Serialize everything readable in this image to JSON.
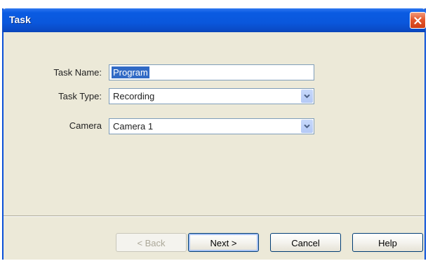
{
  "window": {
    "title": "Task"
  },
  "form": {
    "task_name": {
      "label": "Task Name:",
      "value": "Program"
    },
    "task_type": {
      "label": "Task Type:",
      "value": "Recording"
    },
    "camera": {
      "label": "Camera",
      "value": "Camera 1"
    }
  },
  "buttons": {
    "back": "< Back",
    "next": "Next >",
    "cancel": "Cancel",
    "help": "Help"
  },
  "icons": {
    "close": "close-x-icon",
    "dropdown": "chevron-down-icon"
  },
  "colors": {
    "titlebar": "#0a57dc",
    "dialog_bg": "#ece9d8",
    "close_button": "#e5572d",
    "selection": "#316ac5"
  }
}
